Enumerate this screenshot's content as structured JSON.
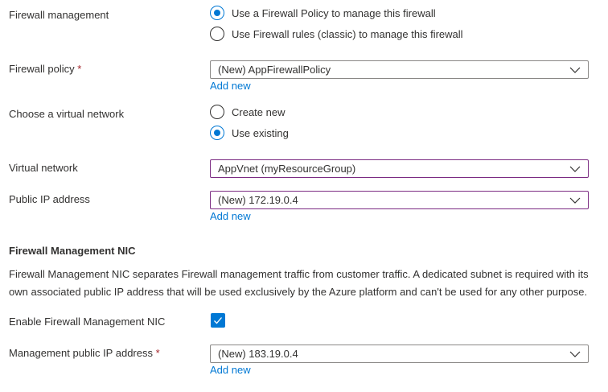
{
  "firewall_management": {
    "label": "Firewall management",
    "options": [
      {
        "label": "Use a Firewall Policy to manage this firewall",
        "checked": true
      },
      {
        "label": "Use Firewall rules (classic) to manage this firewall",
        "checked": false
      }
    ]
  },
  "firewall_policy": {
    "label": "Firewall policy",
    "required": "*",
    "value": "(New) AppFirewallPolicy",
    "add_new": "Add new"
  },
  "virtual_network_choice": {
    "label": "Choose a virtual network",
    "options": [
      {
        "label": "Create new",
        "checked": false
      },
      {
        "label": "Use existing",
        "checked": true
      }
    ]
  },
  "virtual_network": {
    "label": "Virtual network",
    "value": "AppVnet (myResourceGroup)"
  },
  "public_ip": {
    "label": "Public IP address",
    "value": "(New) 172.19.0.4",
    "add_new": "Add new"
  },
  "management_nic": {
    "title": "Firewall Management NIC",
    "description": "Firewall Management NIC separates Firewall management traffic from customer traffic. A dedicated subnet is required with its own associated public IP address that will be used exclusively by the Azure platform and can't be used for any other purpose.",
    "enable_label": "Enable Firewall Management NIC",
    "enabled": true,
    "mgmt_ip_label": "Management public IP address",
    "required": "*",
    "mgmt_ip_value": "(New) 183.19.0.4",
    "add_new": "Add new"
  },
  "colors": {
    "accent": "#0078d4",
    "focus_border": "#7b2b82",
    "required": "#a4262c"
  },
  "icons": [
    "radio-icon",
    "chevron-down-icon",
    "checkmark-icon"
  ]
}
